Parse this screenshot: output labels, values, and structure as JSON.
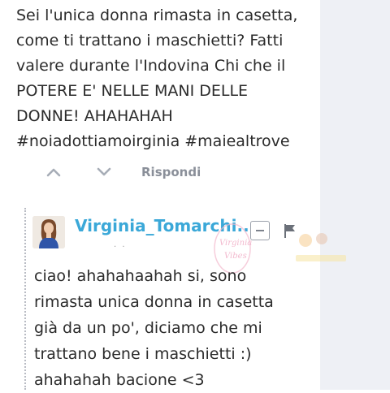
{
  "comment": {
    "text": "Sei l'unica donna rimasta in casetta,\ncome ti trattano i maschietti? Fatti\nvalere durante l'Indovina Chi che il\nPOTERE E' NELLE MANI DELLE\nDONNE! AHAHAHAH\n#noiadottiamoirginia #maiealtrove",
    "actions": {
      "upvote_icon": "chevron-up-icon",
      "downvote_icon": "chevron-down-icon",
      "reply_label": "Rispondi"
    }
  },
  "reply": {
    "username": "Virginia_Tomarchi...",
    "avatar_icon": "user-avatar",
    "collapse_icon": "minus-icon",
    "flag_icon": "flag-icon",
    "text": "ciao! ahahahaahah si, sono\nrimasta unica donna in casetta\ngià da un po', diciamo che mi\ntrattano bene i maschietti :)\nahahahah bacione <3"
  },
  "watermark": {
    "text": "Virginia Vibes"
  },
  "colors": {
    "username": "#3ba8d8",
    "body_text": "#2b2b2b",
    "muted": "#8a8f99",
    "side_panel": "#eef0f5"
  }
}
